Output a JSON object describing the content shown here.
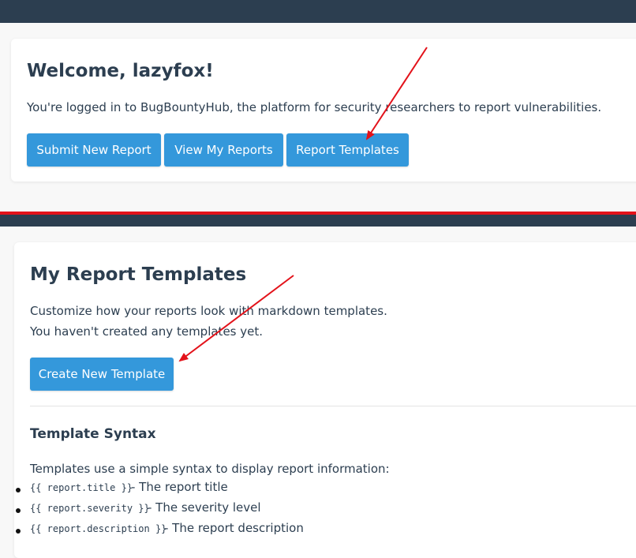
{
  "welcome": {
    "title": "Welcome, lazyfox!",
    "subtitle": "You're logged in to BugBountyHub, the platform for security researchers to report vulnerabilities.",
    "buttons": {
      "submit": "Submit New Report",
      "view": "View My Reports",
      "templates": "Report Templates"
    }
  },
  "templates": {
    "title": "My Report Templates",
    "description": "Customize how your reports look with markdown templates.",
    "empty_message": "You haven't created any templates yet.",
    "create_button": "Create New Template",
    "syntax": {
      "heading": "Template Syntax",
      "intro": "Templates use a simple syntax to display report information:",
      "items": [
        {
          "code": "{{ report.title }}",
          "desc": " - The report title"
        },
        {
          "code": "{{ report.severity }}",
          "desc": " - The severity level"
        },
        {
          "code": "{{ report.description }}",
          "desc": " - The report description"
        }
      ]
    }
  },
  "colors": {
    "nav": "#2c3e50",
    "primary_button": "#3498db",
    "divider": "#e3121a",
    "arrow": "#e3121a"
  }
}
